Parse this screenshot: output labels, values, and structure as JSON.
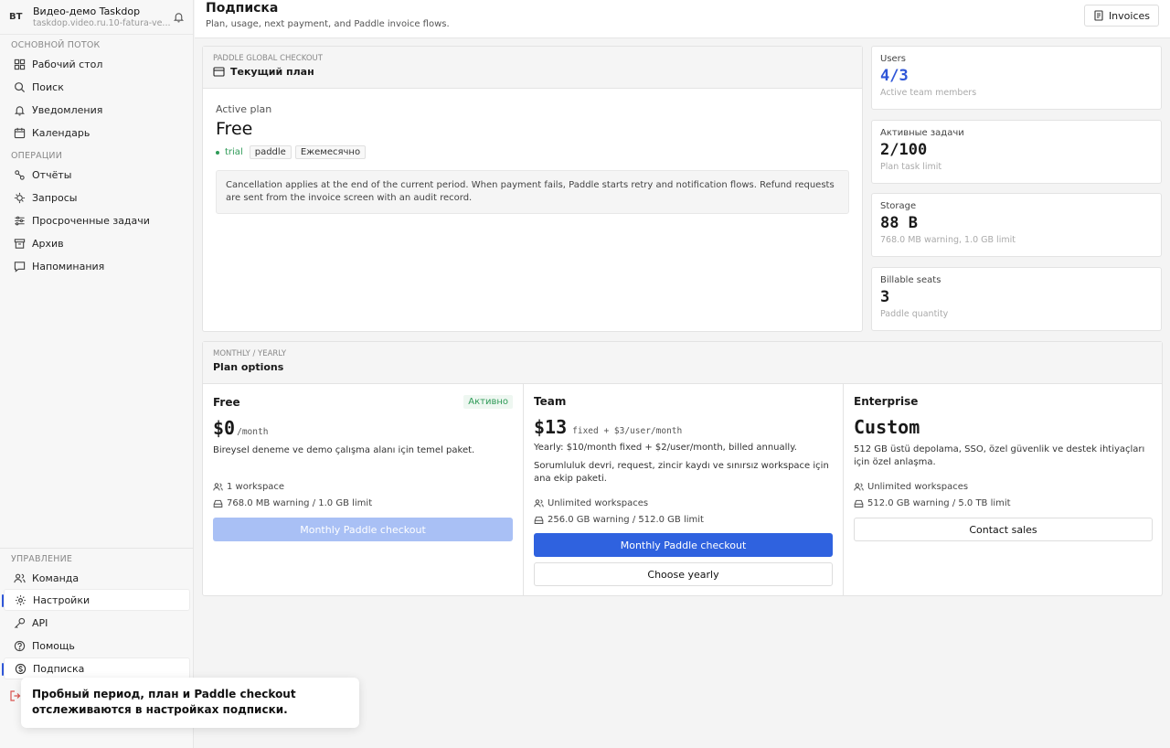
{
  "workspace": {
    "avatar": "BT",
    "name": "Видео-демо Taskdop",
    "url": "taskdop.video.ru.10-fatura-ve..."
  },
  "sidebar": {
    "section_main": "ОСНОВНОЙ ПОТОК",
    "main_items": [
      "Рабочий стол",
      "Поиск",
      "Уведомления",
      "Календарь"
    ],
    "section_ops": "ОПЕРАЦИИ",
    "ops_items": [
      "Отчёты",
      "Запросы",
      "Просроченные задачи",
      "Архив",
      "Напоминания"
    ],
    "section_mgmt": "УПРАВЛЕНИЕ",
    "mgmt_items": [
      "Команда",
      "Настройки",
      "API",
      "Помощь",
      "Подписка"
    ]
  },
  "toast": {
    "text": "Пробный период, план и Paddle checkout отслеживаются в настройках подписки."
  },
  "header": {
    "title": "Подписка",
    "subtitle": "Plan, usage, next payment, and Paddle invoice flows.",
    "invoices_label": "Invoices"
  },
  "current_plan": {
    "kicker": "PADDLE GLOBAL CHECKOUT",
    "title": "Текущий план",
    "active_label": "Active plan",
    "plan_name": "Free",
    "status": "trial",
    "provider_tag": "paddle",
    "period_tag": "Ежемесячно",
    "info": "Cancellation applies at the end of the current period. When payment fails, Paddle starts retry and notification flows. Refund requests are sent from the invoice screen with an audit record."
  },
  "stats": [
    {
      "label": "Users",
      "value": "4/3",
      "note": "Active team members"
    },
    {
      "label": "Активные задачи",
      "value": "2/100",
      "note": "Plan task limit"
    },
    {
      "label": "Storage",
      "value": "88 B",
      "note": "768.0 MB warning, 1.0 GB limit"
    },
    {
      "label": "Billable seats",
      "value": "3",
      "note": "Paddle quantity"
    }
  ],
  "plan_options": {
    "kicker": "MONTHLY / YEARLY",
    "title": "Plan options",
    "plans": [
      {
        "name": "Free",
        "badge": "Активно",
        "price": "$0",
        "price_suffix": "/month",
        "desc": "Bireysel deneme ve demo çalışma alanı için temel paket.",
        "features": [
          "1 workspace",
          "768.0 MB warning / 1.0 GB limit"
        ],
        "primary_button": "Monthly Paddle checkout"
      },
      {
        "name": "Team",
        "price": "$13",
        "price_suffix": "fixed + $3/user/month",
        "yearly_note": "Yearly: $10/month fixed + $2/user/month, billed annually.",
        "desc": "Sorumluluk devri, request, zincir kaydı ve sınırsız workspace için ana ekip paketi.",
        "features": [
          "Unlimited workspaces",
          "256.0 GB warning / 512.0 GB limit"
        ],
        "primary_button": "Monthly Paddle checkout",
        "secondary_button": "Choose yearly"
      },
      {
        "name": "Enterprise",
        "price": "Custom",
        "desc": "512 GB üstü depolama, SSO, özel güvenlik ve destek ihtiyaçları için özel anlaşma.",
        "features": [
          "Unlimited workspaces",
          "512.0 GB warning / 5.0 TB limit"
        ],
        "primary_button": "Contact sales"
      }
    ]
  },
  "colors": {
    "accent": "#2f62df",
    "status_green": "#2e9a57",
    "value_blue": "#2f56d8"
  }
}
